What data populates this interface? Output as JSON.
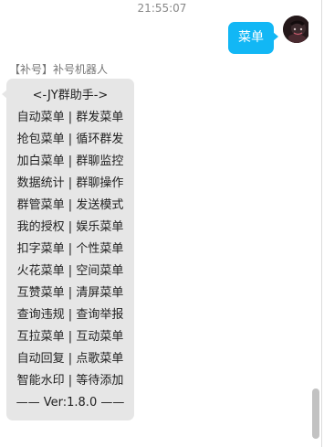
{
  "chat": {
    "timestamp": "21:55:07",
    "outgoing": {
      "text": "菜单"
    },
    "incoming": {
      "sender": "【补号】补号机器人",
      "lines": [
        "<-JY群助手->",
        "自动菜单 | 群发菜单",
        "抢包菜单 | 循环群发",
        "加白菜单 | 群聊监控",
        "数据统计 | 群聊操作",
        "群管菜单 | 发送模式",
        "我的授权 | 娱乐菜单",
        "扣字菜单 | 个性菜单",
        "火花菜单 | 空间菜单",
        "互赞菜单 | 清屏菜单",
        "查询违规 | 查询举报",
        "互拉菜单 | 互动菜单",
        "自动回复 | 点歌菜单",
        "智能水印 | 等待添加",
        "—— Ver:1.8.0 ——"
      ]
    }
  },
  "icons": {
    "self_avatar": "user-avatar-icon"
  },
  "colors": {
    "outgoing_bubble": "#12b7f5",
    "incoming_bubble": "#e6e6e6",
    "scrollbar_thumb": "#c2c2c2"
  }
}
